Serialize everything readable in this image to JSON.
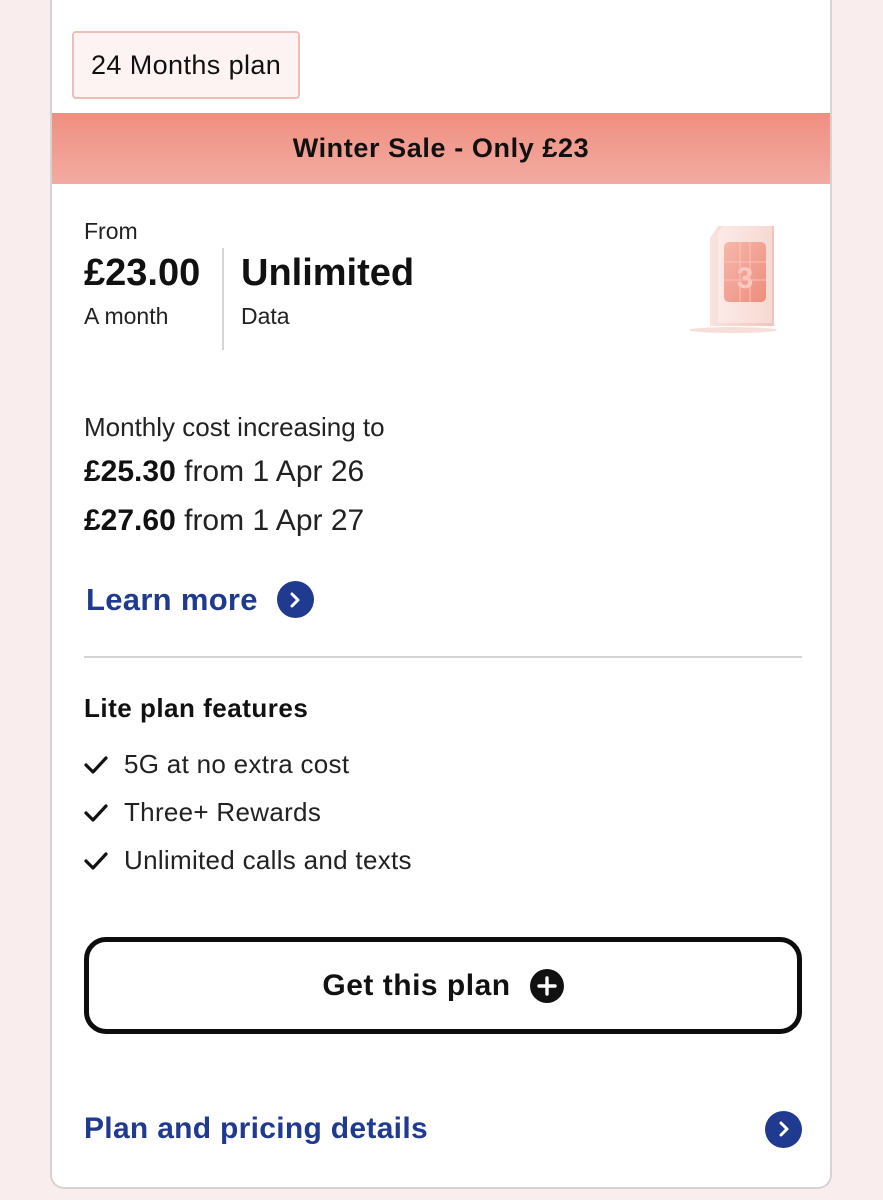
{
  "plan_tag": "24 Months plan",
  "sale_banner": "Winter Sale - Only £23",
  "pricing": {
    "from_label": "From",
    "price": "£23.00",
    "price_unit": "A month",
    "data_value": "Unlimited",
    "data_unit": "Data"
  },
  "cost_increase": {
    "heading": "Monthly cost increasing to",
    "rows": [
      {
        "amount": "£25.30",
        "date": "from 1 Apr 26"
      },
      {
        "amount": "£27.60",
        "date": "from 1 Apr 27"
      }
    ]
  },
  "learn_more_label": "Learn more",
  "features": {
    "title": "Lite plan features",
    "items": [
      "5G at no extra cost",
      "Three+ Rewards",
      "Unlimited calls and texts"
    ]
  },
  "cta": {
    "label": "Get this plan"
  },
  "pricing_details_label": "Plan and pricing details",
  "colors": {
    "accent_blue": "#1f3a8f",
    "sale_banner": "#ef8f80",
    "tag_border": "#f0bdb8"
  },
  "icons": {
    "learn_more": "chevron-right-circle-icon",
    "feature": "check-icon",
    "cta": "plus-circle-icon",
    "pricing_details": "chevron-right-circle-icon",
    "product": "sim-card-image"
  }
}
